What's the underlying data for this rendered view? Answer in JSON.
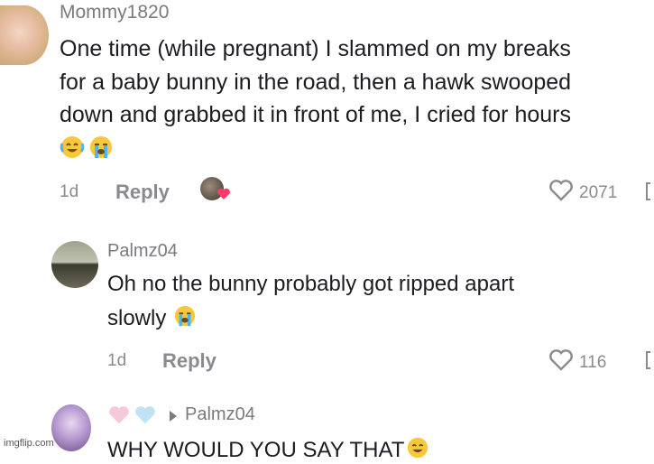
{
  "comments": [
    {
      "username": "Mommy1820",
      "lines": [
        "One time (while pregnant) I slammed on my breaks",
        "for a baby bunny in the road, then a hawk swooped",
        "down and grabbed it in front of me, I cried for hours"
      ],
      "emojis": [
        "laughing-crying-icon",
        "loudly-crying-icon"
      ],
      "age": "1d",
      "reply_label": "Reply",
      "likes": "2071"
    },
    {
      "username": "Palmz04",
      "lines": [
        "Oh no the bunny probably got ripped apart",
        "slowly"
      ],
      "emojis": [
        "loudly-crying-icon"
      ],
      "age": "1d",
      "reply_label": "Reply",
      "likes": "116"
    },
    {
      "username_prefix_emojis": [
        "pink-heart-icon",
        "light-blue-heart-icon"
      ],
      "reply_to": "Palmz04",
      "text": "WHY WOULD YOU SAY THAT",
      "emojis": [
        "laughing-crying-icon"
      ]
    }
  ],
  "watermark": "imgflip.com"
}
